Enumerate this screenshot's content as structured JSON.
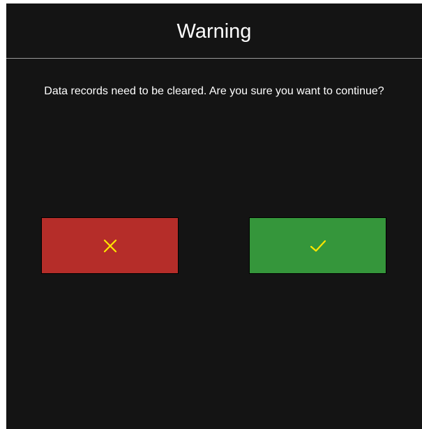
{
  "dialog": {
    "title": "Warning",
    "message": "Data records need to be cleared. Are you sure you want to continue?",
    "cancel_button": {
      "icon": "close-icon",
      "color": "#b52d29",
      "icon_color": "#ffe600"
    },
    "confirm_button": {
      "icon": "check-icon",
      "color": "#35963b",
      "icon_color": "#ffe600"
    }
  }
}
